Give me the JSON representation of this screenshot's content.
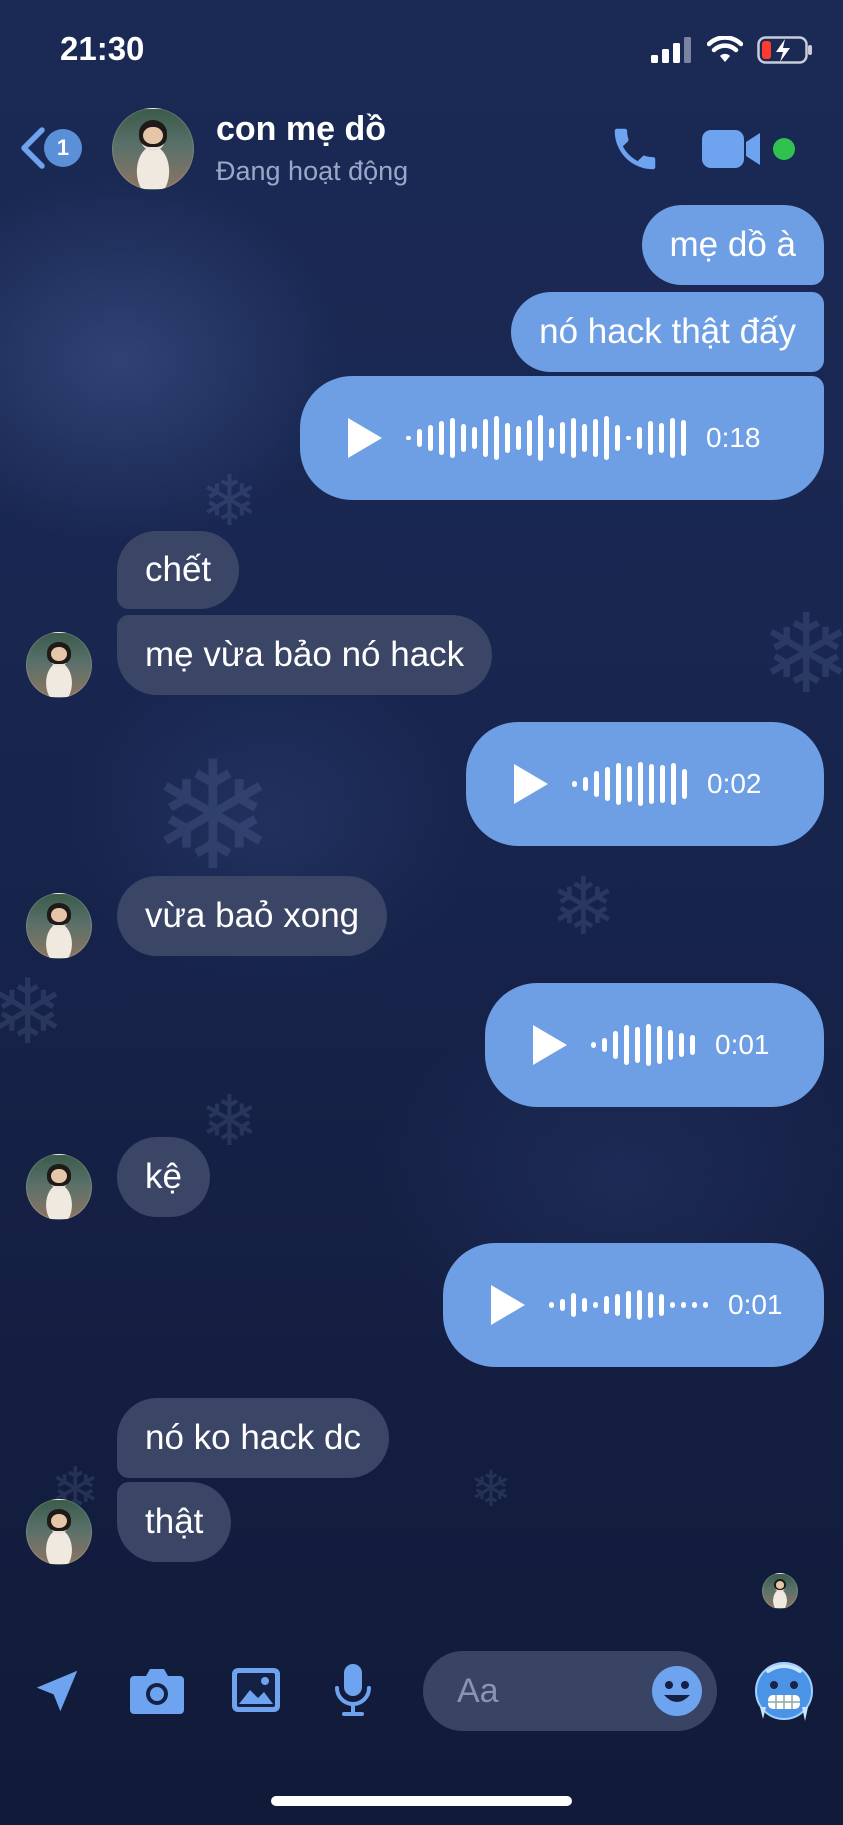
{
  "status_bar": {
    "time": "21:30"
  },
  "header": {
    "unread_count": "1",
    "contact_name": "con mẹ dồ",
    "presence": "Đang hoạt động"
  },
  "messages": [
    {
      "direction": "out",
      "type": "text",
      "text": "mẹ dồ à"
    },
    {
      "direction": "out",
      "type": "text",
      "text": "nó hack thật đấy"
    },
    {
      "direction": "out",
      "type": "voice",
      "duration": "0:18"
    },
    {
      "direction": "in",
      "type": "text",
      "text": "chết"
    },
    {
      "direction": "in",
      "type": "text",
      "text": "mẹ vừa bảo nó hack"
    },
    {
      "direction": "out",
      "type": "voice",
      "duration": "0:02"
    },
    {
      "direction": "in",
      "type": "text",
      "text": "vừa baỏ xong"
    },
    {
      "direction": "out",
      "type": "voice",
      "duration": "0:01"
    },
    {
      "direction": "in",
      "type": "text",
      "text": "kệ"
    },
    {
      "direction": "out",
      "type": "voice",
      "duration": "0:01"
    },
    {
      "direction": "in",
      "type": "text",
      "text": "nó ko hack dc"
    },
    {
      "direction": "in",
      "type": "text",
      "text": "thật"
    }
  ],
  "composer": {
    "placeholder": "Aa",
    "icons": [
      "location-arrow-icon",
      "camera-icon",
      "gallery-icon",
      "microphone-icon",
      "emoji-icon",
      "cold-face-emoji"
    ]
  },
  "colors": {
    "outgoing_bubble": "#6e9ee3",
    "incoming_bubble": "#3b4566",
    "accent": "#5b8fd8",
    "online": "#31c24d"
  }
}
